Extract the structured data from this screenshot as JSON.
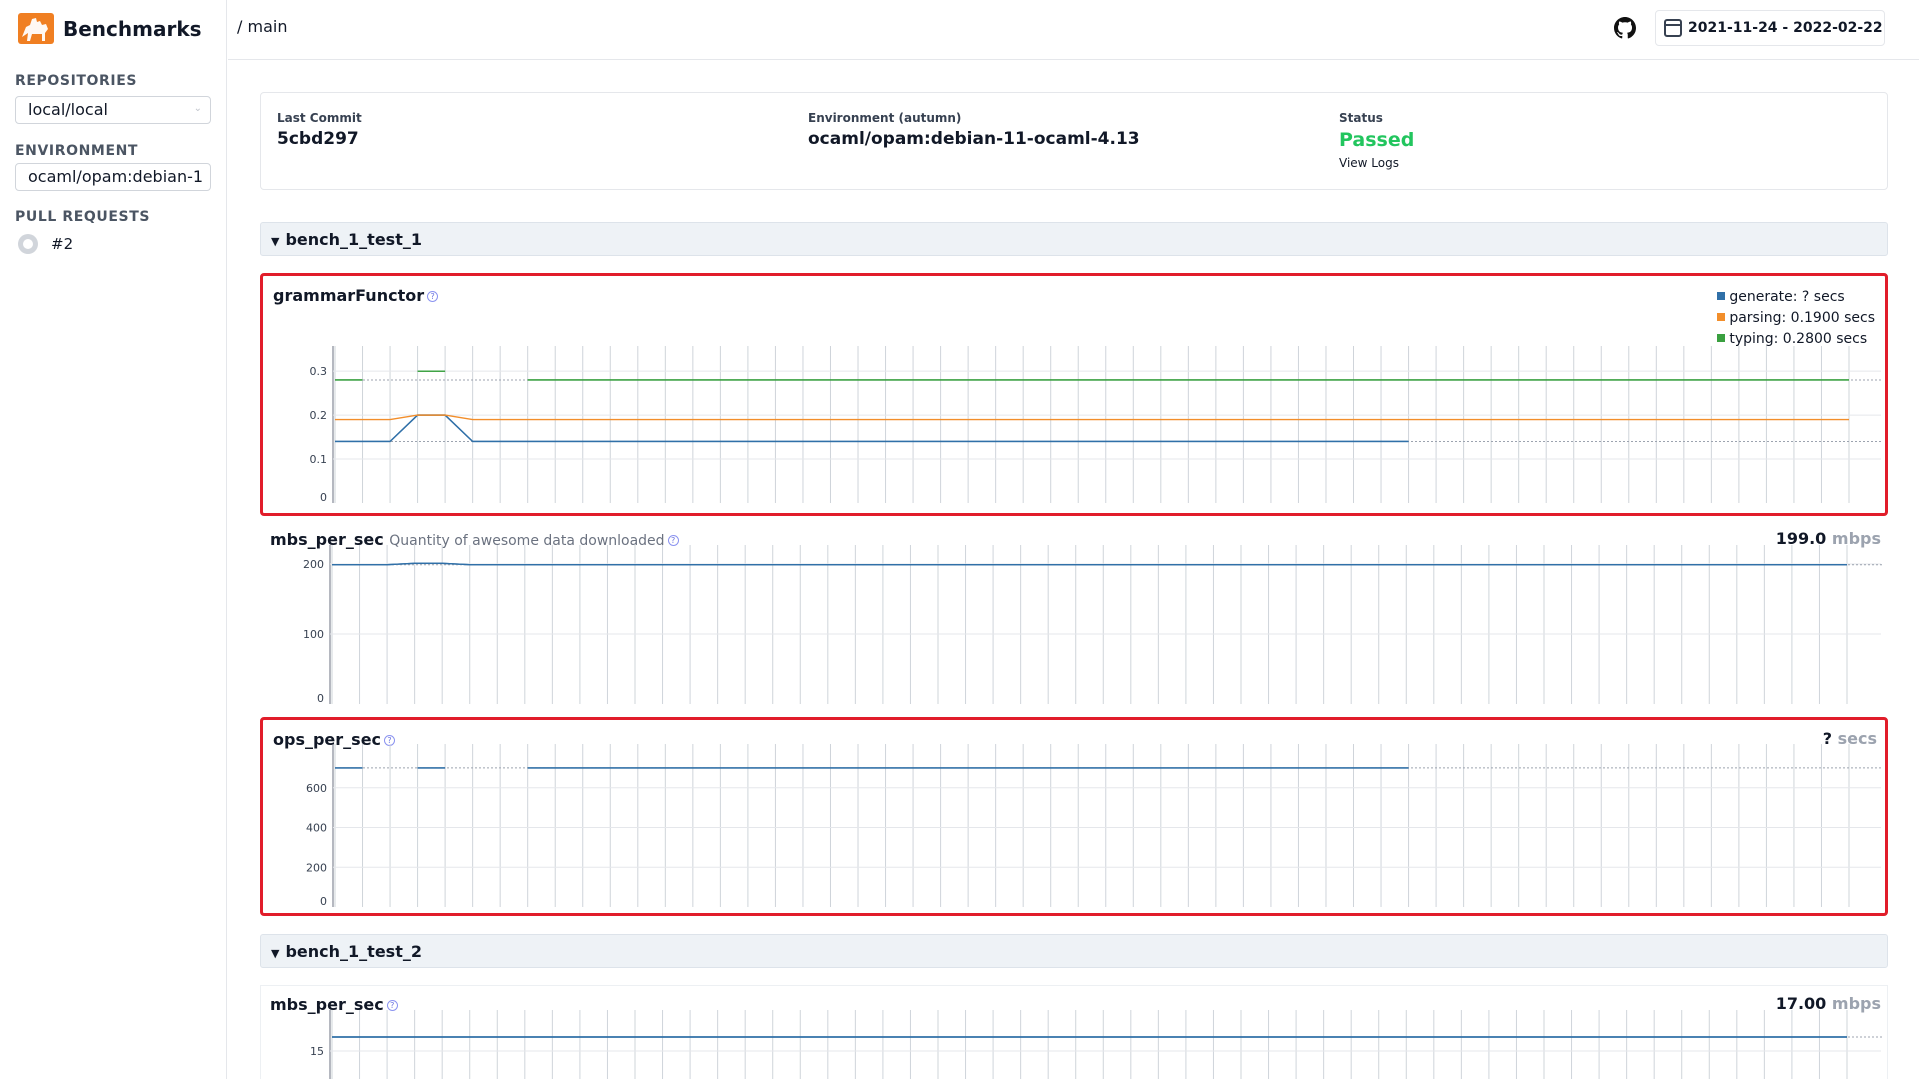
{
  "app": {
    "title": "Benchmarks"
  },
  "sidebar": {
    "repositories_label": "REPOSITORIES",
    "repository_value": "local/local",
    "environment_label": "ENVIRONMENT",
    "environment_value": "ocaml/opam:debian-1",
    "pull_requests_label": "PULL REQUESTS",
    "pull_requests": [
      {
        "label": "#2"
      }
    ]
  },
  "topbar": {
    "breadcrumb": "/ main",
    "date_range": "2021-11-24 - 2022-02-22"
  },
  "info": {
    "last_commit_label": "Last Commit",
    "last_commit": "5cbd297",
    "environment_label": "Environment (autumn)",
    "environment": "ocaml/opam:debian-11-ocaml-4.13",
    "status_label": "Status",
    "status": "Passed",
    "view_logs": "View Logs"
  },
  "colors": {
    "blue": "#3070a8",
    "orange": "#f28e2b",
    "green": "#3aa040",
    "highlight": "#e11d2a",
    "passed": "#22c55e"
  },
  "sections": [
    {
      "title": "bench_1_test_1"
    },
    {
      "title": "bench_1_test_2"
    }
  ],
  "panels": [
    {
      "title": "grammarFunctor",
      "legend": [
        "generate: ? secs",
        "parsing: 0.1900 secs",
        "typing: 0.2800 secs"
      ]
    },
    {
      "title": "mbs_per_sec",
      "description": "Quantity of awesome data downloaded",
      "value": "199.0",
      "unit": "mbps"
    },
    {
      "title": "ops_per_sec",
      "value": "?",
      "unit": "secs"
    },
    {
      "title": "mbs_per_sec",
      "value": "17.00",
      "unit": "mbps"
    }
  ],
  "chart_data": [
    {
      "type": "line",
      "title": "grammarFunctor",
      "ylim": [
        0,
        0.33
      ],
      "yticks": [
        "0",
        "0.1",
        "0.2",
        "0.3"
      ],
      "n_points": 56,
      "series": [
        {
          "name": "generate",
          "color": "#3070a8",
          "values": [
            0.14,
            0.14,
            0.14,
            0.2,
            0.2,
            0.14,
            0.14,
            0.14,
            0.14,
            0.14,
            0.14,
            0.14,
            0.14,
            0.14,
            0.14,
            0.14,
            0.14,
            0.14,
            0.14,
            0.14,
            0.14,
            0.14,
            0.14,
            0.14,
            0.14,
            0.14,
            0.14,
            0.14,
            0.14,
            0.14,
            0.14,
            0.14,
            0.14,
            0.14,
            0.14,
            0.14,
            0.14,
            0.14,
            0.14,
            0.14,
            null,
            null,
            null,
            null,
            null,
            null,
            null,
            null,
            null,
            null,
            null,
            null,
            null,
            null,
            null,
            null
          ],
          "dashed_to_end": 0.14
        },
        {
          "name": "parsing",
          "color": "#f28e2b",
          "values": [
            0.19,
            0.19,
            0.19,
            0.2,
            0.2,
            0.19,
            0.19,
            0.19,
            0.19,
            0.19,
            0.19,
            0.19,
            0.19,
            0.19,
            0.19,
            0.19,
            0.19,
            0.19,
            0.19,
            0.19,
            0.19,
            0.19,
            0.19,
            0.19,
            0.19,
            0.19,
            0.19,
            0.19,
            0.19,
            0.19,
            0.19,
            0.19,
            0.19,
            0.19,
            0.19,
            0.19,
            0.19,
            0.19,
            0.19,
            0.19,
            0.19,
            0.19,
            0.19,
            0.19,
            0.19,
            0.19,
            0.19,
            0.19,
            0.19,
            0.19,
            0.19,
            0.19,
            0.19,
            0.19,
            0.19,
            0.19
          ]
        },
        {
          "name": "typing",
          "color": "#3aa040",
          "values": [
            0.28,
            0.28,
            null,
            0.3,
            0.3,
            null,
            null,
            0.28,
            0.28,
            0.28,
            0.28,
            0.28,
            0.28,
            0.28,
            0.28,
            0.28,
            0.28,
            0.28,
            0.28,
            0.28,
            0.28,
            0.28,
            0.28,
            0.28,
            0.28,
            0.28,
            0.28,
            0.28,
            0.28,
            0.28,
            0.28,
            0.28,
            0.28,
            0.28,
            0.28,
            0.28,
            0.28,
            0.28,
            0.28,
            0.28,
            0.28,
            0.28,
            0.28,
            0.28,
            0.28,
            0.28,
            0.28,
            0.28,
            0.28,
            0.28,
            0.28,
            0.28,
            0.28,
            0.28,
            0.28,
            0.28
          ],
          "dashed_to_end": 0.28
        }
      ]
    },
    {
      "type": "line",
      "title": "mbs_per_sec",
      "ylim": [
        0,
        210
      ],
      "yticks": [
        "0",
        "100",
        "200"
      ],
      "n_points": 56,
      "series": [
        {
          "name": "mbs_per_sec",
          "color": "#3070a8",
          "values": [
            199,
            199,
            199,
            201,
            201,
            199,
            199,
            199,
            199,
            199,
            199,
            199,
            199,
            199,
            199,
            199,
            199,
            199,
            199,
            199,
            199,
            199,
            199,
            199,
            199,
            199,
            199,
            199,
            199,
            199,
            199,
            199,
            199,
            199,
            199,
            199,
            199,
            199,
            199,
            199,
            199,
            199,
            199,
            199,
            199,
            199,
            199,
            199,
            199,
            199,
            199,
            199,
            199,
            199,
            199,
            199
          ],
          "dashed_to_end": 199
        }
      ]
    },
    {
      "type": "line",
      "title": "ops_per_sec",
      "ylim": [
        0,
        760
      ],
      "yticks": [
        "0",
        "200",
        "400",
        "600"
      ],
      "n_points": 56,
      "series": [
        {
          "name": "ops_per_sec",
          "color": "#3070a8",
          "values": [
            700,
            700,
            null,
            700,
            700,
            null,
            null,
            700,
            700,
            700,
            700,
            700,
            700,
            700,
            700,
            700,
            700,
            700,
            700,
            700,
            700,
            700,
            700,
            700,
            700,
            700,
            700,
            700,
            700,
            700,
            700,
            700,
            700,
            700,
            700,
            700,
            700,
            700,
            700,
            700,
            null,
            null,
            null,
            null,
            null,
            null,
            null,
            null,
            null,
            null,
            null,
            null,
            null,
            null,
            null,
            null
          ],
          "dashed_to_end": 700
        }
      ]
    },
    {
      "type": "line",
      "title": "mbs_per_sec",
      "ylim": [
        0,
        19
      ],
      "yticks": [
        "15"
      ],
      "n_points": 56,
      "series": [
        {
          "name": "mbs_per_sec",
          "color": "#3070a8",
          "values": [
            17,
            17,
            17,
            17,
            17,
            17,
            17,
            17,
            17,
            17,
            17,
            17,
            17,
            17,
            17,
            17,
            17,
            17,
            17,
            17,
            17,
            17,
            17,
            17,
            17,
            17,
            17,
            17,
            17,
            17,
            17,
            17,
            17,
            17,
            17,
            17,
            17,
            17,
            17,
            17,
            17,
            17,
            17,
            17,
            17,
            17,
            17,
            17,
            17,
            17,
            17,
            17,
            17,
            17,
            17,
            17
          ],
          "dashed_to_end": 17
        }
      ]
    }
  ]
}
